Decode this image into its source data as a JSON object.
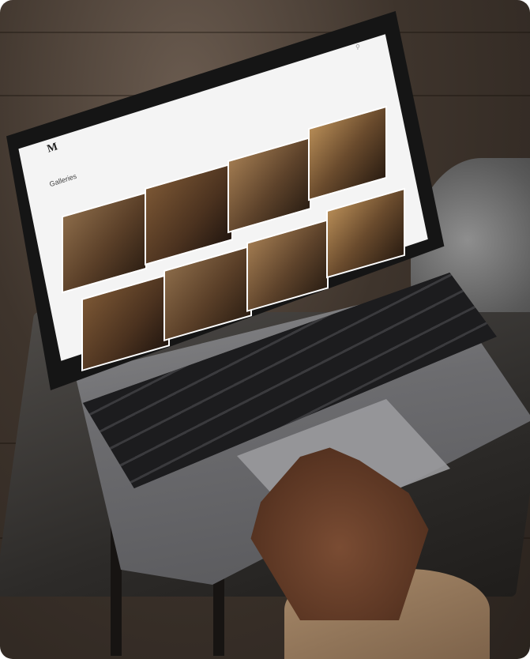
{
  "screen": {
    "logo": "M",
    "page_title": "Galleries",
    "breadcrumb": "",
    "top_right_label": "",
    "top_icon": "search-icon"
  },
  "tiles": [
    {
      "caption": ""
    },
    {
      "caption": ""
    },
    {
      "caption": ""
    },
    {
      "caption": ""
    },
    {
      "caption": ""
    },
    {
      "caption": ""
    },
    {
      "caption": ""
    },
    {
      "caption": ""
    }
  ]
}
